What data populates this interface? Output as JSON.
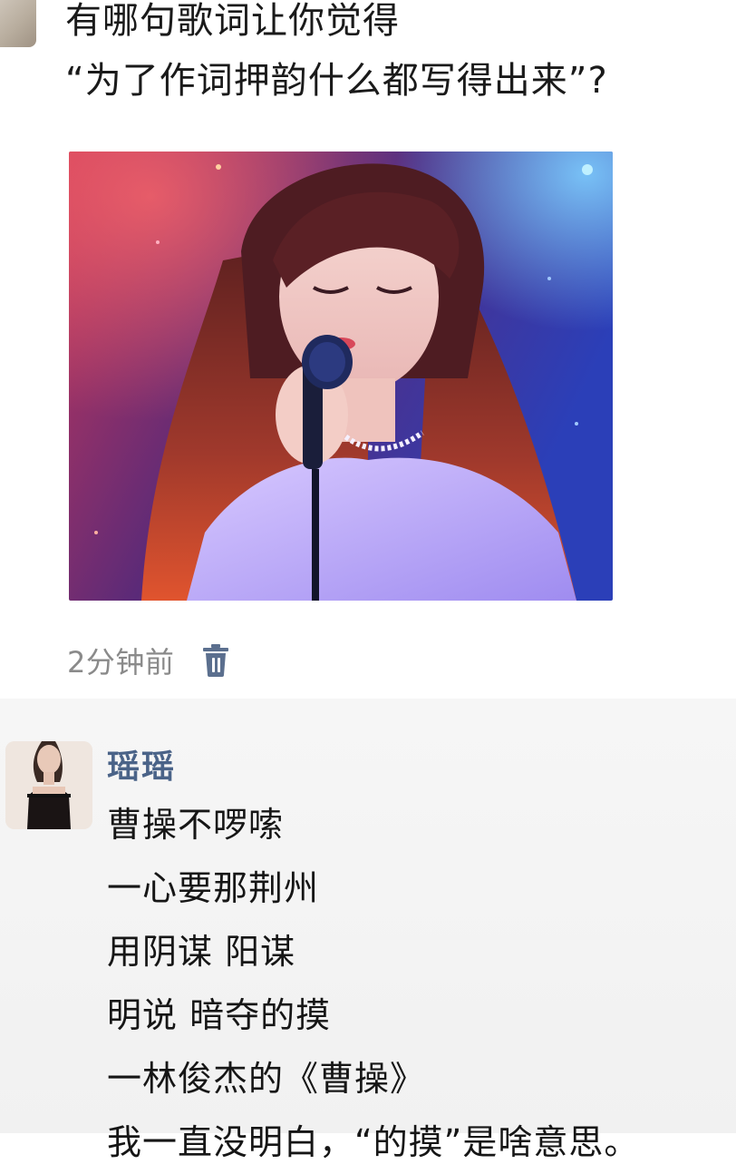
{
  "post": {
    "title_line1": "有哪句歌词让你觉得",
    "title_line2": "“为了作词押韵什么都写得出来”?",
    "image_subject": "anime-style woman singing into a microphone on a stage",
    "time_ago": "2分钟前",
    "delete_icon": "trash-icon"
  },
  "reply": {
    "username": "瑶瑶",
    "lines": [
      "曹操不啰嗦",
      "一心要那荆州",
      "用阴谋 阳谋",
      "明说 暗夺的摸",
      "一林俊杰的《曹操》",
      "我一直没明白，“的摸”是啥意思。"
    ]
  },
  "colors": {
    "username": "#4a6388",
    "meta_text": "#8a8a8a",
    "reply_background": "#f4f4f4"
  }
}
